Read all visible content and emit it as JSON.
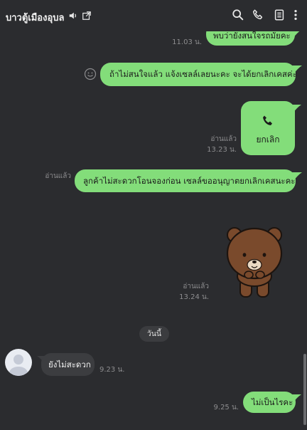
{
  "header": {
    "title": "บาวตู้เมืองอุบล",
    "icons": [
      "speaker-icon",
      "external-window-icon",
      "search-icon",
      "phone-icon",
      "note-icon",
      "more-icon"
    ]
  },
  "messages": {
    "m0": {
      "text": "พบว่ายังสนใจรถมัยคะ",
      "time": "11.03 น."
    },
    "m1": {
      "text": "ถ้าไม่สนใจแล้ว  แจ้งเซลล์เลยนะคะ  จะได้ยกเลิกเคสค่ะ"
    },
    "m2": {
      "call_label": "ยกเลิก",
      "read": "อ่านแล้ว",
      "time": "13.23 น."
    },
    "m3": {
      "text": "ลูกค้าไม่สะดวกโอนจองก่อน  เซลล์ขออนุญาตยกเลิกเคสนะคะ",
      "read": "อ่านแล้ว"
    },
    "m4": {
      "read": "อ่านแล้ว",
      "time": "13.24 น."
    },
    "date": "วันนี้",
    "m5": {
      "text": "ยังไม่สะดวก",
      "time": "9.23 น."
    },
    "m6": {
      "text": "ไม่เป็นไรคะ",
      "time": "9.25 น."
    }
  },
  "colors": {
    "background": "#2b2c2f",
    "outgoing": "#83dd7a",
    "incoming": "#3c3d40"
  }
}
